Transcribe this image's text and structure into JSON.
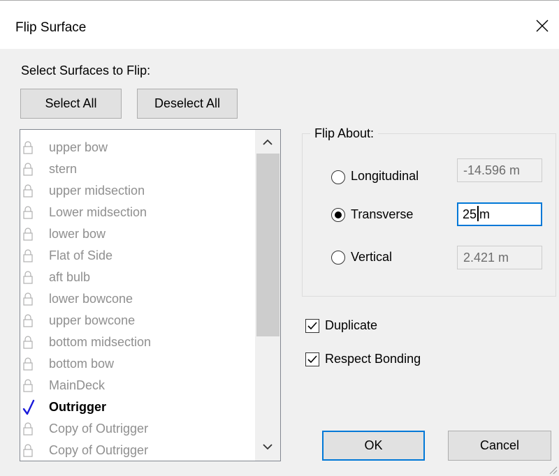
{
  "dialog": {
    "title": "Flip Surface",
    "close_icon": "close-icon"
  },
  "selection": {
    "heading": "Select Surfaces to Flip:",
    "select_all_label": "Select All",
    "deselect_all_label": "Deselect All"
  },
  "surfaces": [
    {
      "name": "upper bow",
      "icon": "lock-icon",
      "checked": false
    },
    {
      "name": "stern",
      "icon": "lock-icon",
      "checked": false
    },
    {
      "name": "upper midsection",
      "icon": "lock-icon",
      "checked": false
    },
    {
      "name": "Lower midsection",
      "icon": "lock-icon",
      "checked": false
    },
    {
      "name": "lower bow",
      "icon": "lock-icon",
      "checked": false
    },
    {
      "name": "Flat of Side",
      "icon": "lock-icon",
      "checked": false
    },
    {
      "name": "aft bulb",
      "icon": "lock-icon",
      "checked": false
    },
    {
      "name": "lower bowcone",
      "icon": "lock-icon",
      "checked": false
    },
    {
      "name": "upper bowcone",
      "icon": "lock-icon",
      "checked": false
    },
    {
      "name": "bottom midsection",
      "icon": "lock-icon",
      "checked": false
    },
    {
      "name": "bottom bow",
      "icon": "lock-icon",
      "checked": false
    },
    {
      "name": "MainDeck",
      "icon": "lock-icon",
      "checked": false
    },
    {
      "name": "Outrigger",
      "icon": "check-icon",
      "checked": true
    },
    {
      "name": "Copy of Outrigger",
      "icon": "lock-icon",
      "checked": false
    },
    {
      "name": "Copy of Outrigger",
      "icon": "lock-icon",
      "checked": false
    }
  ],
  "flip_about": {
    "legend": "Flip About:",
    "selected": "Transverse",
    "longitudinal": {
      "label": "Longitudinal",
      "value": "-14.596 m"
    },
    "transverse": {
      "label": "Transverse",
      "value_before_caret": "25",
      "value_after_caret": "m"
    },
    "vertical": {
      "label": "Vertical",
      "value": "2.421 m"
    }
  },
  "options": {
    "duplicate": {
      "label": "Duplicate",
      "checked": true
    },
    "respect_bonding": {
      "label": "Respect Bonding",
      "checked": true
    }
  },
  "actions": {
    "ok_label": "OK",
    "cancel_label": "Cancel"
  },
  "colors": {
    "accent": "#0078d7",
    "disabled_text": "#8f8f8f",
    "check_mark": "#1a1adb"
  }
}
